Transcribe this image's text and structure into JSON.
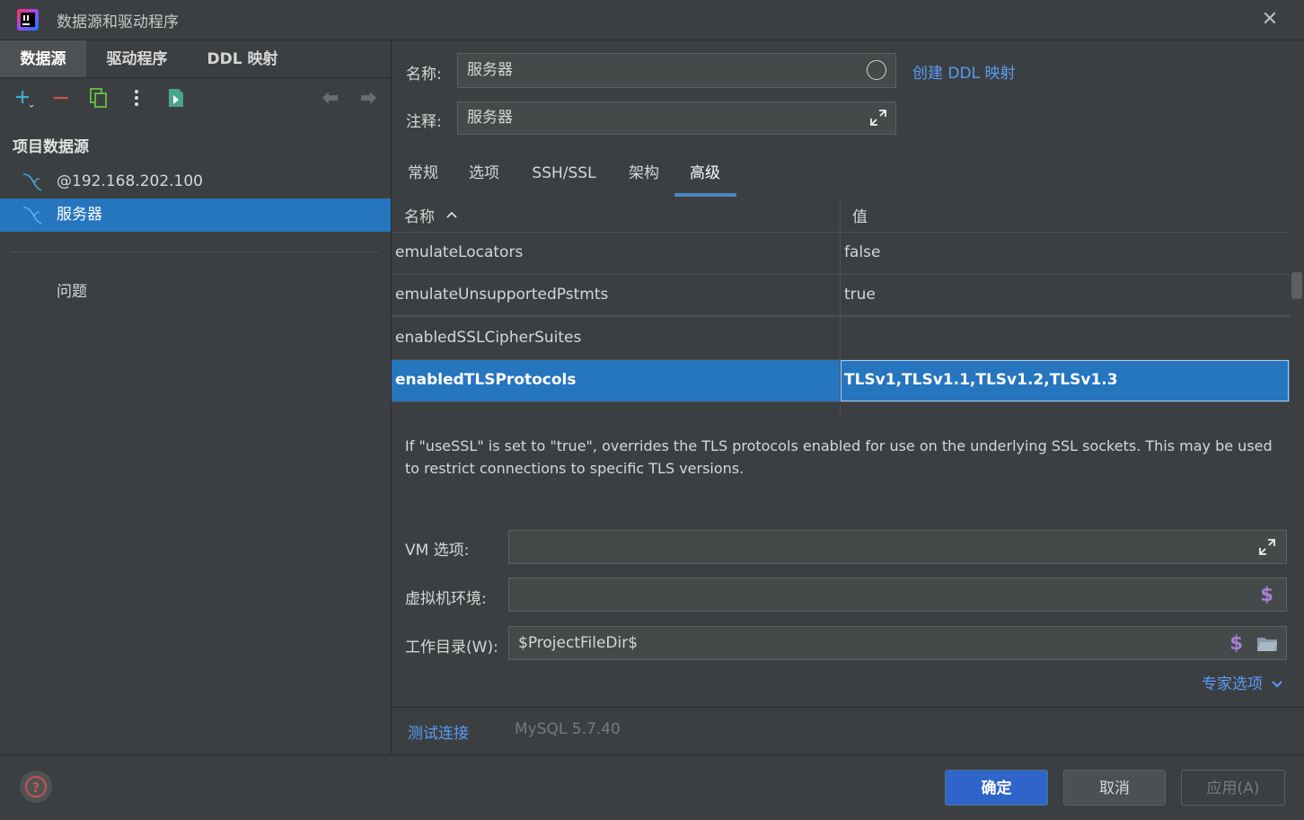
{
  "window": {
    "title": "数据源和驱动程序",
    "close_symbol": "✕"
  },
  "left": {
    "tabs": [
      "数据源",
      "驱动程序",
      "DDL 映射"
    ],
    "toolbar_icons": [
      "add-icon",
      "remove-icon",
      "duplicate-icon",
      "more-icon",
      "import-icon",
      "back-icon",
      "forward-icon"
    ],
    "add_symbol": "+",
    "remove_symbol": "−",
    "section_title": "项目数据源",
    "datasources": [
      {
        "label": "@192.168.202.100",
        "selected": false
      },
      {
        "label": "服务器",
        "selected": true
      }
    ],
    "problems_label": "问题"
  },
  "form": {
    "name_label": "名称:",
    "name_value": "服务器",
    "comment_label": "注释:",
    "comment_value": "服务器",
    "create_ddl_link": "创建 DDL 映射"
  },
  "subtabs": {
    "items": [
      "常规",
      "选项",
      "SSH/SSL",
      "架构",
      "高级"
    ],
    "active": "高级"
  },
  "table": {
    "col_name": "名称",
    "col_value": "值",
    "rows": [
      {
        "name": "emulateLocators",
        "value": "false"
      },
      {
        "name": "emulateUnsupportedPstmts",
        "value": "true"
      },
      {
        "name": "enabledSSLCipherSuites",
        "value": ""
      },
      {
        "name": "enabledTLSProtocols",
        "value": "TLSv1,TLSv1.1,TLSv1.2,TLSv1.3"
      }
    ],
    "selected_row": 3
  },
  "description": "If \"useSSL\" is set to \"true\", overrides the TLS protocols enabled for use on the underlying SSL sockets. This may be used to restrict connections to specific TLS versions.",
  "vm": {
    "vm_options_label": "VM 选项:",
    "vm_options_value": "",
    "vm_env_label": "虚拟机环境:",
    "vm_env_value": "",
    "workdir_label": "工作目录(W):",
    "workdir_value": "$ProjectFileDir$",
    "macro_symbol": "$"
  },
  "expert_options": "专家选项",
  "test_connection": "测试连接",
  "driver_version": "MySQL 5.7.40",
  "footer": {
    "help_symbol": "?",
    "ok": "确定",
    "cancel": "取消",
    "apply": "应用(A)"
  },
  "colors": {
    "background": "#3c3f41",
    "selection": "#2675bf",
    "link": "#589df6",
    "primary_button": "#2f65ca",
    "accent_macro": "#a77fd7",
    "add_icon": "#3fa7d6",
    "remove_icon": "#c75450",
    "help_icon": "#c75450"
  }
}
